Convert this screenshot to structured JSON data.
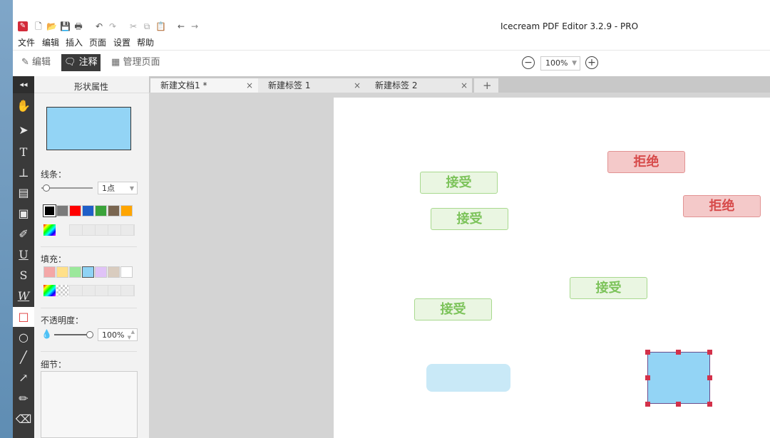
{
  "app": {
    "title": "Icecream PDF Editor 3.2.9 - PRO"
  },
  "menu": [
    "文件",
    "编辑",
    "插入",
    "页面",
    "设置",
    "帮助"
  ],
  "modes": {
    "edit": "编辑",
    "annotate": "注释",
    "manage": "管理页面"
  },
  "zoom": {
    "value": "100%"
  },
  "tabs": [
    {
      "label": "新建文档1 *",
      "close": "×"
    },
    {
      "label": "新建标签 1",
      "close": "×"
    },
    {
      "label": "新建标签 2",
      "close": "×"
    }
  ],
  "add_tab": "+",
  "panel": {
    "title": "形状属性",
    "stroke_label": "线条：",
    "stroke_width": "1点",
    "fill_label": "填充：",
    "opacity_label": "不透明度：",
    "opacity_value": "100%",
    "details_label": "细节：",
    "stroke_colors": [
      "#000000",
      "#7a7a7a",
      "#ff0000",
      "#1f5fc8",
      "#3aa33a",
      "#7a6650",
      "#ffa500"
    ],
    "fill_colors": [
      "#f4a7a7",
      "#ffe08a",
      "#9be89b",
      "#8fd3f5",
      "#e0c3f7",
      "#d9ccbf",
      "#ffffff"
    ],
    "preview_fill": "#93d4f5"
  },
  "canvas": {
    "stamps": [
      {
        "text": "接受",
        "kind": "accept"
      },
      {
        "text": "接受",
        "kind": "accept"
      },
      {
        "text": "接受",
        "kind": "accept"
      },
      {
        "text": "接受",
        "kind": "accept"
      },
      {
        "text": "拒绝",
        "kind": "reject"
      },
      {
        "text": "拒绝",
        "kind": "reject"
      }
    ],
    "shape_fill": "#93d4f5",
    "faded_fill": "#c9e9f7"
  }
}
